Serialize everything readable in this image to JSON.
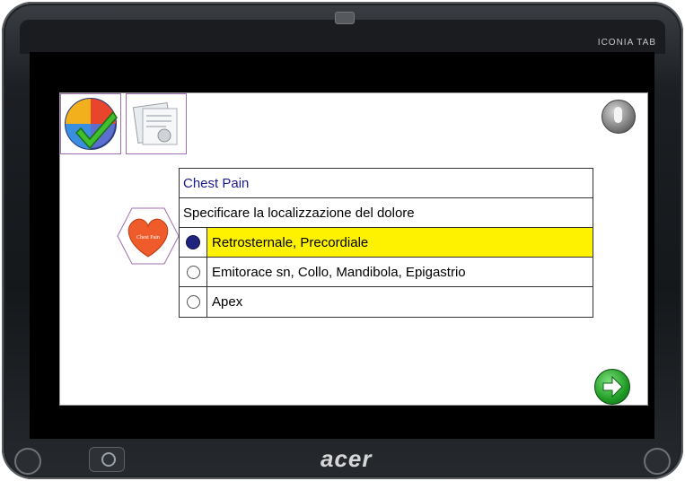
{
  "device": {
    "model_label": "ICONIA TAB",
    "brand": "acer"
  },
  "toolbar": {
    "confirm_icon": "windows-check-icon",
    "document_icon": "document-icon",
    "mic_icon": "microphone-icon"
  },
  "section": {
    "badge_icon": "chest-pain-heart-icon",
    "badge_text": "Chest Pain"
  },
  "form": {
    "title": "Chest Pain",
    "prompt": "Specificare la localizzazione del dolore",
    "options": [
      {
        "label": "Retrosternale, Precordiale",
        "selected": true
      },
      {
        "label": "Emitorace sn, Collo, Mandibola, Epigastrio",
        "selected": false
      },
      {
        "label": "Apex",
        "selected": false
      }
    ]
  },
  "navigation": {
    "next_icon": "arrow-right-icon"
  },
  "colors": {
    "selected_highlight": "#fff200",
    "title_text": "#1a1a8a",
    "radio_selected": "#1f237f"
  }
}
